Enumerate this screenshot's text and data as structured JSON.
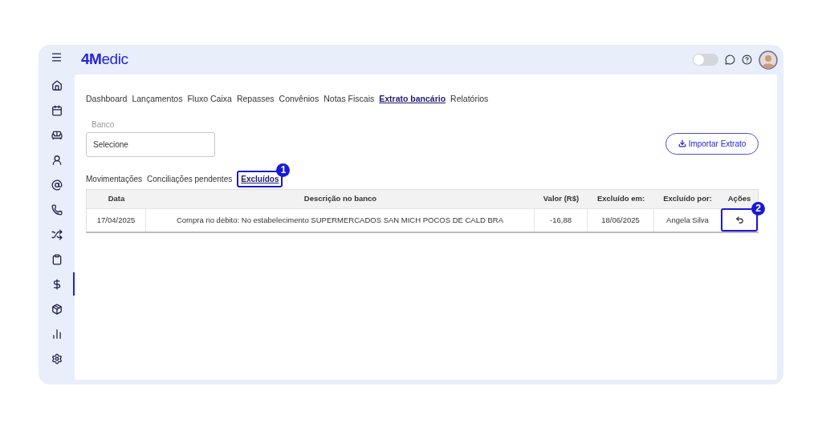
{
  "header": {
    "logo": "**4M**edic",
    "theme_toggle": {
      "on": false
    }
  },
  "sidebar": {
    "items": [
      {
        "kind": "home",
        "selected": false
      },
      {
        "kind": "calendar",
        "selected": false
      },
      {
        "kind": "sofa",
        "selected": false
      },
      {
        "kind": "user",
        "selected": false
      },
      {
        "kind": "at",
        "selected": false
      },
      {
        "kind": "phone",
        "selected": false
      },
      {
        "kind": "shuffle",
        "selected": false
      },
      {
        "kind": "clipboard",
        "selected": false
      },
      {
        "kind": "dollar",
        "selected": true
      },
      {
        "kind": "package",
        "selected": false
      },
      {
        "kind": "chart",
        "selected": false
      },
      {
        "kind": "settings",
        "selected": false
      }
    ]
  },
  "nav_tabs": [
    {
      "label": "Dashboard",
      "selected": false
    },
    {
      "label": "Lançamentos",
      "selected": false
    },
    {
      "label": "Fluxo Caixa",
      "selected": false
    },
    {
      "label": "Repasses",
      "selected": false
    },
    {
      "label": "Convênios",
      "selected": false
    },
    {
      "label": "Notas Fiscais",
      "selected": false
    },
    {
      "label": "Extrato bancário",
      "selected": true
    },
    {
      "label": "Relatórios",
      "selected": false
    }
  ],
  "bank_field": {
    "label": "Banco",
    "value": "Selecione"
  },
  "import_button": "Importar Extrato",
  "sub_tabs": [
    {
      "label": "Movimentações",
      "selected": false
    },
    {
      "label": "Conciliações pendentes",
      "selected": false
    },
    {
      "label": "Excluídos",
      "selected": true,
      "callout": "1"
    }
  ],
  "table": {
    "columns": [
      "Data",
      "Descrição no banco",
      "Valor (R$)",
      "Excluído em:",
      "Excluído por:",
      "Ações"
    ],
    "rows": [
      {
        "cells": [
          "17/04/2025",
          "Compra no debito: No estabelecimento SUPERMERCADOS SAN MICH POCOS DE CALD BRA",
          "-16,88",
          "18/06/2025",
          "Angela Silva"
        ],
        "action_callout": "2"
      }
    ]
  }
}
